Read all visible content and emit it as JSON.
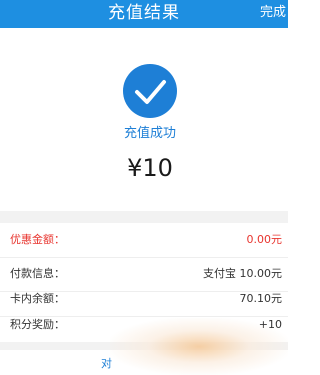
{
  "header": {
    "title": "充值结果",
    "done_label": "完成"
  },
  "status": {
    "icon": "checkmark-circle-icon",
    "text": "充值成功",
    "amount": "¥10"
  },
  "details": [
    {
      "label": "优惠金额：",
      "value": "0.00元",
      "highlight": "#e8352f"
    },
    {
      "label": "付款信息：",
      "value": "支付宝 10.00元"
    },
    {
      "label": "卡内余额：",
      "value": "70.10元"
    },
    {
      "label": "积分奖励：",
      "value": "+10"
    }
  ],
  "footer": {
    "link_text": "对"
  },
  "colors": {
    "header": "#1e8fe1",
    "accent": "#1e7fd6",
    "discount": "#e8352f"
  }
}
